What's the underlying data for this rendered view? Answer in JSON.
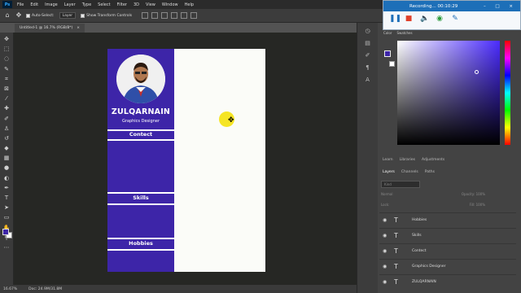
{
  "menubar": {
    "logo": "Ps",
    "items": [
      "File",
      "Edit",
      "Image",
      "Layer",
      "Type",
      "Select",
      "Filter",
      "3D",
      "View",
      "Window",
      "Help"
    ]
  },
  "options": {
    "auto_select": "Auto-Select:",
    "target": "Layer",
    "transform_controls": "Show Transform Controls"
  },
  "document": {
    "tab_title": "Untitled-1 @ 16.7% (RGB/8*)",
    "close": "×"
  },
  "resume": {
    "name": "ZULQARNAIN",
    "role": "Graphics Designer",
    "sections": [
      "Contect",
      "Skills",
      "Hobbies"
    ],
    "colors": {
      "sidebar": "#3d25a8",
      "paper": "#fbfcf8"
    }
  },
  "status": {
    "zoom": "16.67%",
    "doc": "Doc: 24.9M/31.8M"
  },
  "recording": {
    "title": "Recording... 00:10:29"
  },
  "color_panel": {
    "tabs": [
      "Color",
      "Swatches"
    ]
  },
  "panels": {
    "top_tabs": [
      "Learn",
      "Libraries",
      "Adjustments"
    ],
    "layer_tabs": [
      "Layers",
      "Channels",
      "Paths"
    ],
    "search_placeholder": "Kind",
    "blend_mode": "Normal",
    "opacity_label": "Opacity:",
    "opacity_value": "100%",
    "lock_label": "Lock:",
    "fill_label": "Fill:",
    "fill_value": "100%"
  },
  "layers": [
    "Hobbies",
    "Skills",
    "Contect",
    "Graphics Designer",
    "ZULQARNAIN"
  ]
}
